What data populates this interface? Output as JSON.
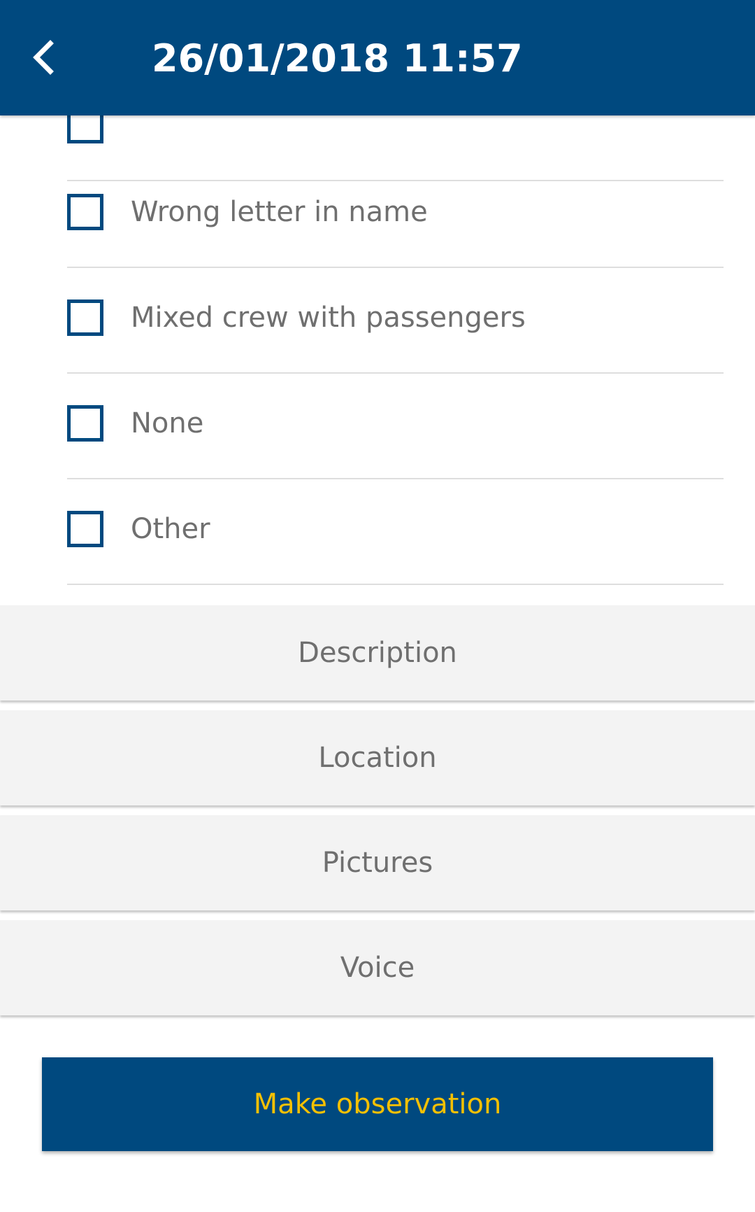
{
  "app_bar": {
    "title": "26/01/2018 11:57",
    "back_icon": "chevron-left-icon",
    "background_color": "#00497f"
  },
  "checklist": {
    "items": [
      {
        "label": "Wrong letter in name",
        "checked": false
      },
      {
        "label": "Mixed crew with passengers",
        "checked": false
      },
      {
        "label": "None",
        "checked": false
      },
      {
        "label": "Other",
        "checked": false
      }
    ]
  },
  "sections": [
    {
      "label": "Description"
    },
    {
      "label": "Location"
    },
    {
      "label": "Pictures"
    },
    {
      "label": "Voice"
    }
  ],
  "primary_action": {
    "label": "Make observation",
    "background_color": "#00497f",
    "text_color": "#f5c000"
  }
}
